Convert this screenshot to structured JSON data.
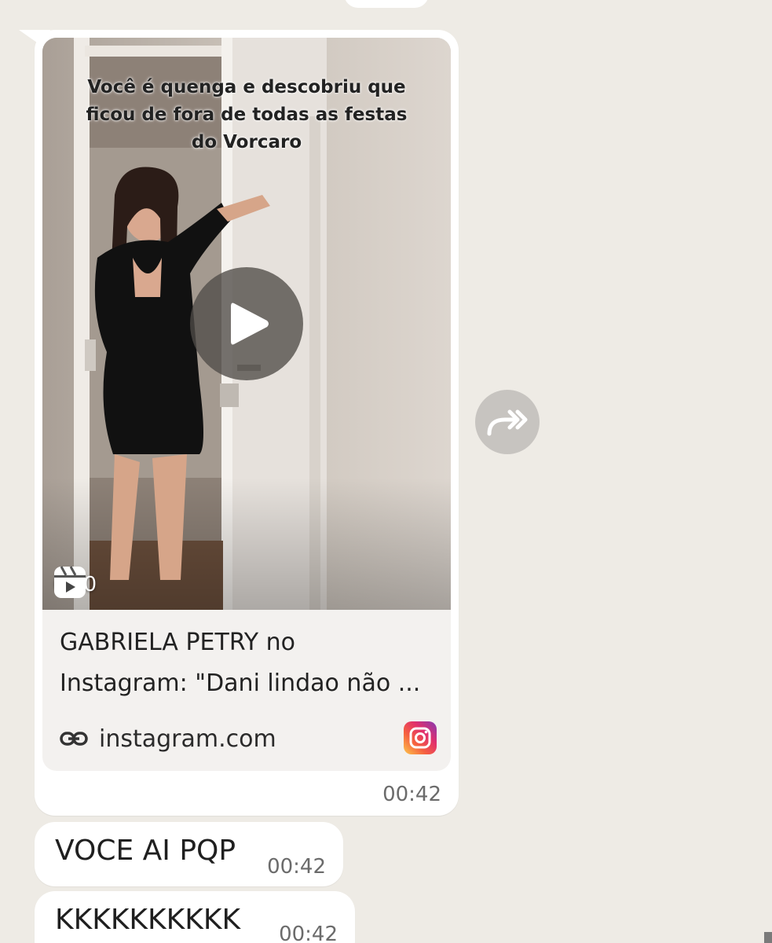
{
  "link_message": {
    "video": {
      "caption": "Você é quenga e descobriu que\nficou de fora de todas as festas\ndo Vorcaro",
      "duration": "0:30",
      "icon": "reel-icon"
    },
    "title": "GABRIELA PETRY no\nInstagram: \"Dani lindao não ...",
    "domain": "instagram.com",
    "link_icon": "link-icon",
    "source_icon": "instagram-icon",
    "time": "00:42"
  },
  "forward_button": {
    "icon": "forward-icon"
  },
  "messages": [
    {
      "text": "VOCE AI PQP",
      "time": "00:42"
    },
    {
      "text": "KKKKKKKKKK",
      "time": "00:42"
    }
  ],
  "colors": {
    "chat_background": "#eeebe5",
    "bubble": "#ffffff",
    "preview_card": "#f3f1ef"
  }
}
